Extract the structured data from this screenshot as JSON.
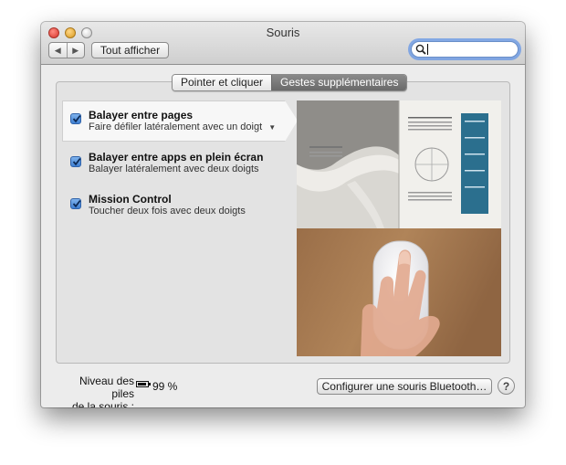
{
  "window": {
    "title": "Souris"
  },
  "toolbar": {
    "back_icon": "chevron-left-icon",
    "forward_icon": "chevron-right-icon",
    "show_all_label": "Tout afficher",
    "search": {
      "value": "",
      "placeholder": "",
      "icon": "search-icon"
    }
  },
  "tabs": [
    {
      "label": "Pointer et cliquer",
      "selected": false
    },
    {
      "label": "Gestes supplémentaires",
      "selected": true
    }
  ],
  "options": [
    {
      "title": "Balayer entre pages",
      "subtitle": "Faire défiler latéralement avec un doigt",
      "checked": true,
      "selected": true,
      "has_dropdown": true
    },
    {
      "title": "Balayer entre apps en plein écran",
      "subtitle": "Balayer latéralement avec deux doigts",
      "checked": true,
      "selected": false,
      "has_dropdown": false
    },
    {
      "title": "Mission Control",
      "subtitle": "Toucher deux fois avec deux doigts",
      "checked": true,
      "selected": false,
      "has_dropdown": false
    }
  ],
  "dropdown_icon": "triangle-down-icon",
  "footer": {
    "battery_label": "Niveau des piles\nde la souris :",
    "battery_label_line1": "Niveau des piles",
    "battery_label_line2": "de la souris :",
    "battery_icon": "battery-icon",
    "battery_level": 0.99,
    "battery_value": "99 %",
    "bluetooth_button": "Configurer une souris Bluetooth…",
    "help_label": "?"
  },
  "colors": {
    "accent": "#3e7fd2",
    "window_bg": "#ececec",
    "focus_ring": "#6496e6"
  }
}
